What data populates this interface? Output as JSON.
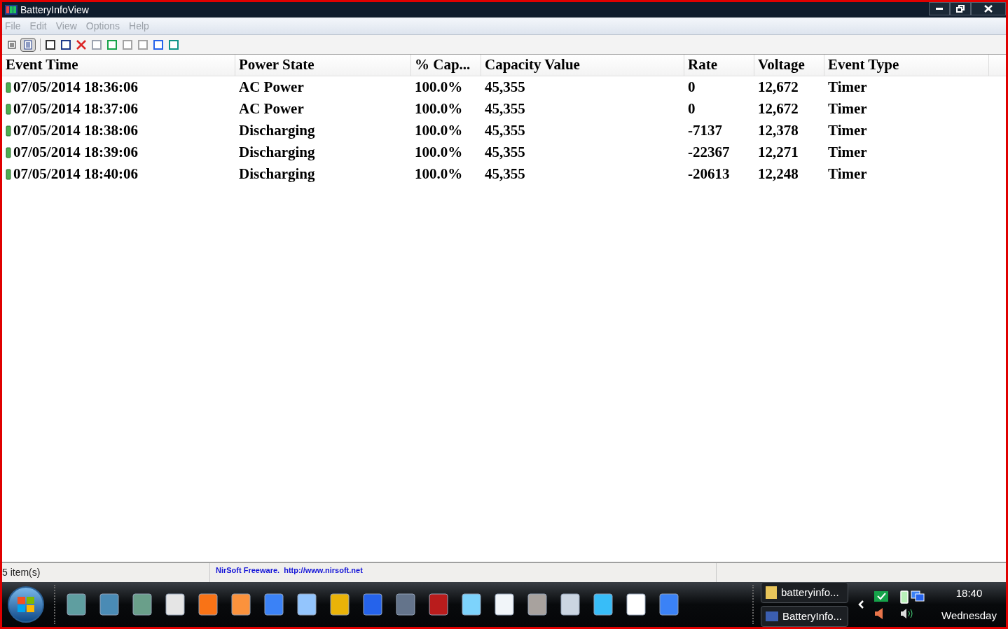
{
  "window": {
    "title": "BatteryInfoView"
  },
  "menu": [
    "File",
    "Edit",
    "View",
    "Options",
    "Help"
  ],
  "table": {
    "columns": [
      "Event Time",
      "Power State",
      "% Cap...",
      "Capacity Value",
      "Rate",
      "Voltage",
      "Event Type"
    ],
    "rows": [
      {
        "cells": [
          "07/05/2014 18:36:06",
          "AC Power",
          "100.0%",
          "45,355",
          "0",
          "12,672",
          "Timer"
        ]
      },
      {
        "cells": [
          "07/05/2014 18:37:06",
          "AC Power",
          "100.0%",
          "45,355",
          "0",
          "12,672",
          "Timer"
        ]
      },
      {
        "cells": [
          "07/05/2014 18:38:06",
          "Discharging",
          "100.0%",
          "45,355",
          "-7137",
          "12,378",
          "Timer"
        ]
      },
      {
        "cells": [
          "07/05/2014 18:39:06",
          "Discharging",
          "100.0%",
          "45,355",
          "-22367",
          "12,271",
          "Timer"
        ]
      },
      {
        "cells": [
          "07/05/2014 18:40:06",
          "Discharging",
          "100.0%",
          "45,355",
          "-20613",
          "12,248",
          "Timer"
        ]
      }
    ]
  },
  "status_bar": {
    "count": "5 item(s)",
    "credit": "NirSoft Freeware.  http://www.nirsoft.net"
  },
  "taskbar": {
    "buttons": [
      {
        "label": "batteryinfo..."
      },
      {
        "label": "BatteryInfo..."
      }
    ],
    "time": "18:40",
    "day": "Wednesday"
  }
}
